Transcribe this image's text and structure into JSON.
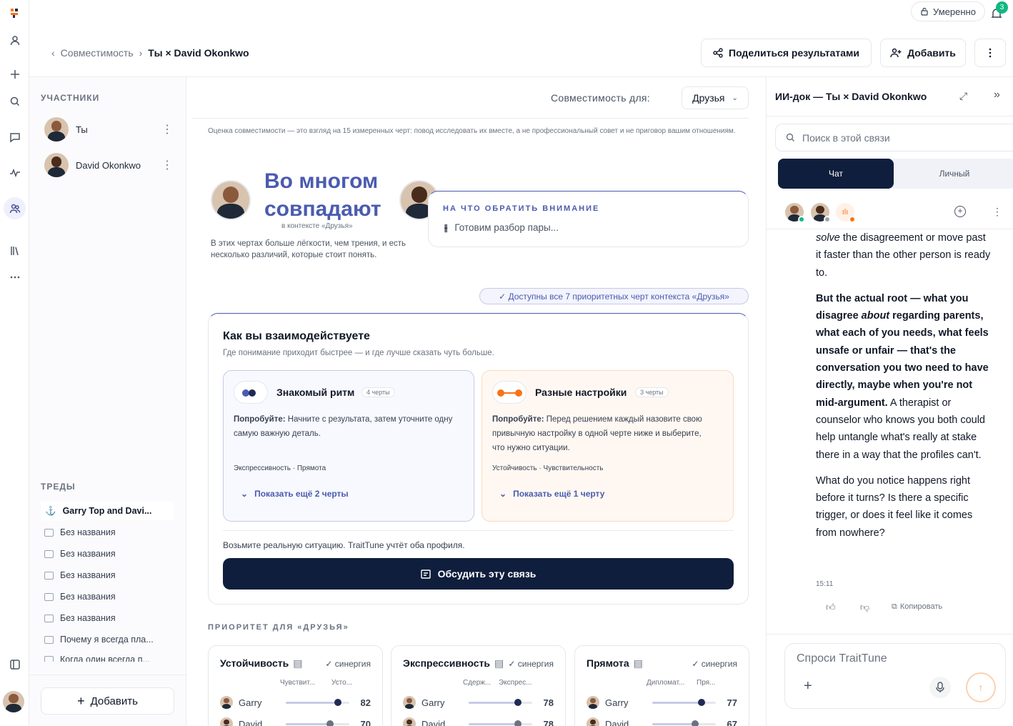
{
  "header": {
    "breadcrumb_parent": "Совместимость",
    "breadcrumb_current": "Ты × David Okonkwo",
    "share_label": "Поделиться результатами",
    "add_label": "Добавить",
    "mood_label": "Умеренно",
    "notif_count": "3"
  },
  "left": {
    "participants_title": "УЧАСТНИКИ",
    "participants": [
      {
        "name": "Ты"
      },
      {
        "name": "David Okonkwo"
      }
    ],
    "threads_title": "ТРЕДЫ",
    "threads": [
      "Garry Top and Davi...",
      "Без названия",
      "Без названия",
      "Без названия",
      "Без названия",
      "Без названия",
      "Почему я всегда пла...",
      "Когда один всегда п..."
    ],
    "add_label": "Добавить"
  },
  "main": {
    "compat_for_label": "Совместимость для:",
    "compat_for_value": "Друзья",
    "disclaimer": "Оценка совместимости — это взгляд на 15 измеренных черт: повод исследовать их вместе, а не профессиональный совет и не приговор вашим отношениям.",
    "headline": "Во многом совпадают",
    "context_note": "в контексте «Друзья»",
    "summary": "В этих чертах больше лёгкости, чем трения, и есть несколько различий, которые стоит понять.",
    "attention_title": "НА ЧТО ОБРАТИТЬ ВНИМАНИЕ",
    "attention_text": "Готовим разбор пары...",
    "badge": "✓ Доступны все 7 приоритетных черт контекста «Друзья»",
    "interact_title": "Как вы взаимодействуете",
    "interact_sub": "Где понимание приходит быстрее — и где лучше сказать чуть больше.",
    "cards": [
      {
        "title": "Знакомый ритм",
        "count": "4 черты",
        "try_label": "Попробуйте:",
        "try_text": "Начните с результата, затем уточните одну самую важную деталь.",
        "traits": "Экспрессивность · Прямота",
        "more": "Показать ещё 2 черты"
      },
      {
        "title": "Разные настройки",
        "count": "3 черты",
        "try_label": "Попробуйте:",
        "try_text": "Перед решением каждый назовите свою привычную настройку в одной черте ниже и выберите, что нужно ситуации.",
        "traits": "Устойчивость · Чувствительность",
        "more": "Показать ещё 1 черту"
      }
    ],
    "situation": "Возьмите реальную ситуацию. TraitTune учтёт оба профиля.",
    "discuss_label": "Обсудить эту связь",
    "priority_title": "ПРИОРИТЕТ ДЛЯ «ДРУЗЬЯ»",
    "trait_cards": [
      {
        "title": "Устойчивость",
        "tag": "синергия",
        "left": "Чувствит...",
        "right": "Усто...",
        "p1": "Garry",
        "v1": "82",
        "p2": "David",
        "v2": "70",
        "f1": 0.82,
        "f2": 0.7
      },
      {
        "title": "Экспрессивность",
        "tag": "синергия",
        "left": "Сдерж...",
        "right": "Экспрес...",
        "p1": "Garry",
        "v1": "78",
        "p2": "David",
        "v2": "78",
        "f1": 0.78,
        "f2": 0.78
      },
      {
        "title": "Прямота",
        "tag": "синергия",
        "left": "Дипломат...",
        "right": "Пря...",
        "p1": "Garry",
        "v1": "77",
        "p2": "David",
        "v2": "67",
        "f1": 0.77,
        "f2": 0.67
      }
    ]
  },
  "ai": {
    "title": "ИИ-док — Ты × David Okonkwo",
    "search_placeholder": "Поиск в этой связи",
    "tab_chat": "Чат",
    "tab_personal": "Личный",
    "msg_a_em": "solve",
    "msg_a_rest": " the disagreement or move past it faster than the other person is ready to.",
    "msg_b_1": "But the actual root — what you disagree ",
    "msg_b_em": "about",
    "msg_b_2": " regarding parents, what each of you needs, what feels unsafe or unfair — that's the conversation you two need to have directly, maybe when you're not mid-argument.",
    "msg_b_3": " A therapist or counselor who knows you both could help untangle what's really at stake there in a way that the profiles can't.",
    "msg_c": "What do you notice happens right before it turns? Is there a specific trigger, or does it feel like it comes from nowhere?",
    "time": "15:11",
    "copy_label": "Копировать",
    "input_placeholder": "Спроси TraitTune"
  }
}
